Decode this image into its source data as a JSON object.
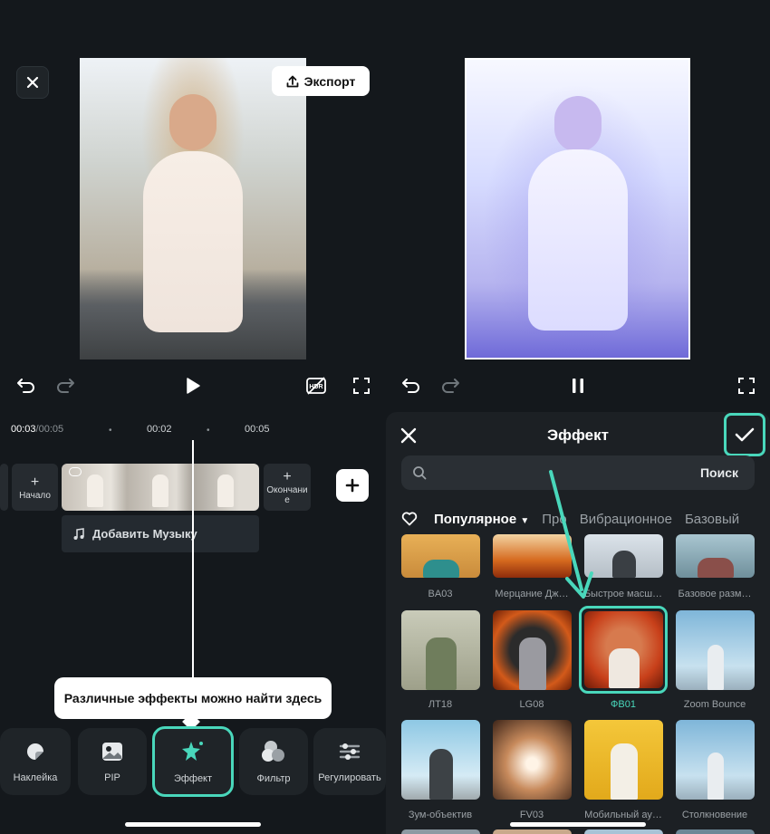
{
  "preview": {
    "close_icon": "close-icon",
    "export_label": "Экспорт",
    "export_icon": "upload-icon"
  },
  "controls_left": [
    "undo-icon",
    "redo-icon",
    "play-icon",
    "hdr-off-icon",
    "fullscreen-icon"
  ],
  "controls_right": [
    "undo-icon",
    "redo-icon",
    "pause-icon",
    "fullscreen-icon"
  ],
  "timeline": {
    "current_time": "00:03",
    "total_time": "/00:05",
    "marks": [
      "00:02",
      "00:05"
    ],
    "start_label": "Начало",
    "end_label": "Окончание",
    "music_label": "Добавить Музыку"
  },
  "tooltip": "Различные эффекты можно найти здесь",
  "toolbar": [
    {
      "name": "sticker",
      "label": "Наклейка",
      "icon": "sticker-icon",
      "active": false
    },
    {
      "name": "pip",
      "label": "PIP",
      "icon": "image-icon",
      "active": false
    },
    {
      "name": "effect",
      "label": "Эффект",
      "icon": "sparkle-icon",
      "active": true
    },
    {
      "name": "filter",
      "label": "Фильтр",
      "icon": "filter-icon",
      "active": false
    },
    {
      "name": "adjust",
      "label": "Регулировать",
      "icon": "sliders-icon",
      "active": false
    }
  ],
  "effect_panel": {
    "title": "Эффект",
    "search_label": "Поиск",
    "tabs": [
      "Популярное",
      "Про",
      "Вибрационное",
      "Базовый"
    ],
    "active_tab": "Популярное",
    "effects_row1": [
      "BA03",
      "Мерцание Дж…",
      "Быстрое масш…",
      "Базовое разм…"
    ],
    "effects_row2": [
      "ЛТ18",
      "LG08",
      "ФВ01",
      "Zoom Bounce"
    ],
    "effects_row3": [
      "Зум-объектив",
      "FV03",
      "Мобильный ау…",
      "Столкновение"
    ],
    "selected_effect": "ФВ01",
    "accent_color": "#49d7bb"
  }
}
